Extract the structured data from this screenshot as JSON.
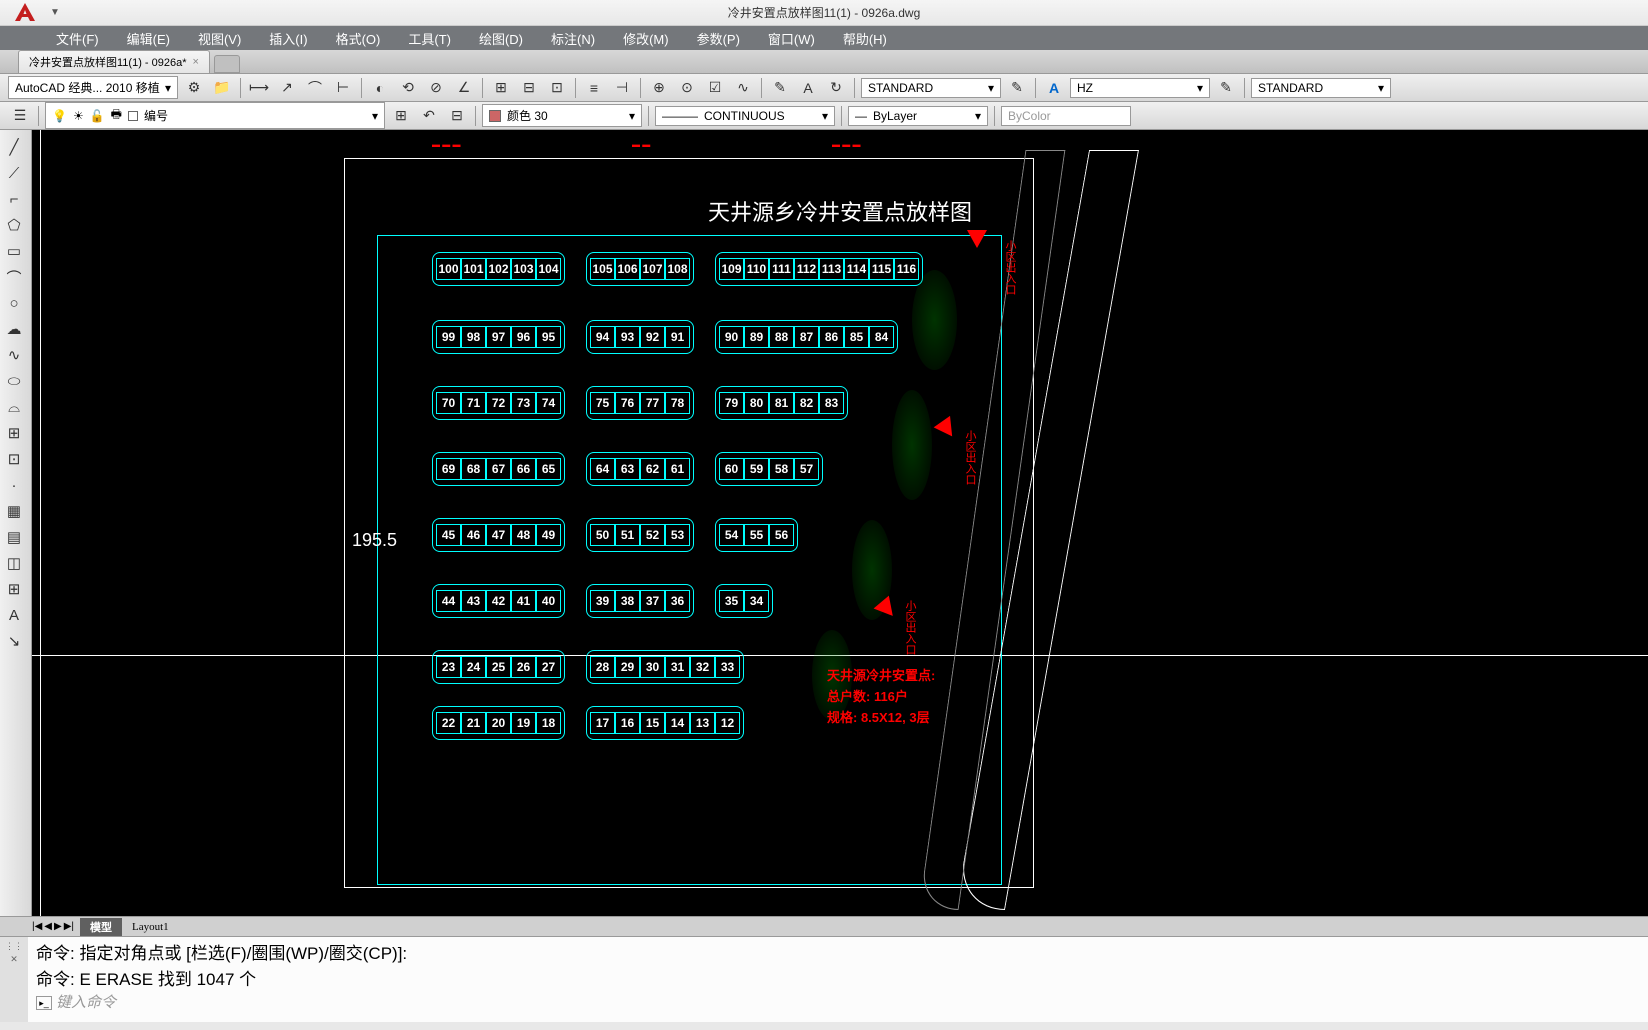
{
  "title": "冷井安置点放样图11(1) - 0926a.dwg",
  "menus": [
    "文件(F)",
    "编辑(E)",
    "视图(V)",
    "插入(I)",
    "格式(O)",
    "工具(T)",
    "绘图(D)",
    "标注(N)",
    "修改(M)",
    "参数(P)",
    "窗口(W)",
    "帮助(H)"
  ],
  "docTab": "冷井安置点放样图11(1) - 0926a*",
  "workspace": "AutoCAD 经典... 2010 移植",
  "textStyle1": "STANDARD",
  "textStyle2": "HZ",
  "dimStyle": "STANDARD",
  "layer": "编号",
  "colorLabel": "颜色 30",
  "linetype": "CONTINUOUS",
  "lineweight": "ByLayer",
  "plotStyle": "ByColor",
  "drawingTitle": "天井源乡冷井安置点放样图",
  "dimension": "195.5",
  "layoutTabs": {
    "model": "模型",
    "layout1": "Layout1"
  },
  "infoBlock": {
    "line1": "天井源冷井安置点:",
    "line2": "总户数: 116户",
    "line3": "规格: 8.5X12, 3层"
  },
  "roadLabels": [
    "小区出入口",
    "小区出入口",
    "小区出入口"
  ],
  "plots": {
    "row1": [
      [
        "100",
        "101",
        "102",
        "103",
        "104"
      ],
      [
        "105",
        "106",
        "107",
        "108"
      ],
      [
        "109",
        "110",
        "111",
        "112",
        "113",
        "114",
        "115",
        "116"
      ]
    ],
    "row2": [
      [
        "99",
        "98",
        "97",
        "96",
        "95"
      ],
      [
        "94",
        "93",
        "92",
        "91"
      ],
      [
        "90",
        "89",
        "88",
        "87",
        "86",
        "85",
        "84"
      ]
    ],
    "row3": [
      [
        "70",
        "71",
        "72",
        "73",
        "74"
      ],
      [
        "75",
        "76",
        "77",
        "78"
      ],
      [
        "79",
        "80",
        "81",
        "82",
        "83"
      ]
    ],
    "row4": [
      [
        "69",
        "68",
        "67",
        "66",
        "65"
      ],
      [
        "64",
        "63",
        "62",
        "61"
      ],
      [
        "60",
        "59",
        "58",
        "57"
      ]
    ],
    "row5": [
      [
        "45",
        "46",
        "47",
        "48",
        "49"
      ],
      [
        "50",
        "51",
        "52",
        "53"
      ],
      [
        "54",
        "55",
        "56"
      ]
    ],
    "row6": [
      [
        "44",
        "43",
        "42",
        "41",
        "40"
      ],
      [
        "39",
        "38",
        "37",
        "36"
      ],
      [
        "35",
        "34"
      ]
    ],
    "row7": [
      [
        "23",
        "24",
        "25",
        "26",
        "27"
      ],
      [
        "28",
        "29",
        "30",
        "31",
        "32",
        "33"
      ]
    ],
    "row8": [
      [
        "22",
        "21",
        "20",
        "19",
        "18"
      ],
      [
        "17",
        "16",
        "15",
        "14",
        "13",
        "12"
      ]
    ]
  },
  "cmd": {
    "line1": "命令: 指定对角点或 [栏选(F)/圈围(WP)/圈交(CP)]:",
    "line2": "命令: E ERASE 找到 1047 个",
    "placeholder": "键入命令"
  }
}
